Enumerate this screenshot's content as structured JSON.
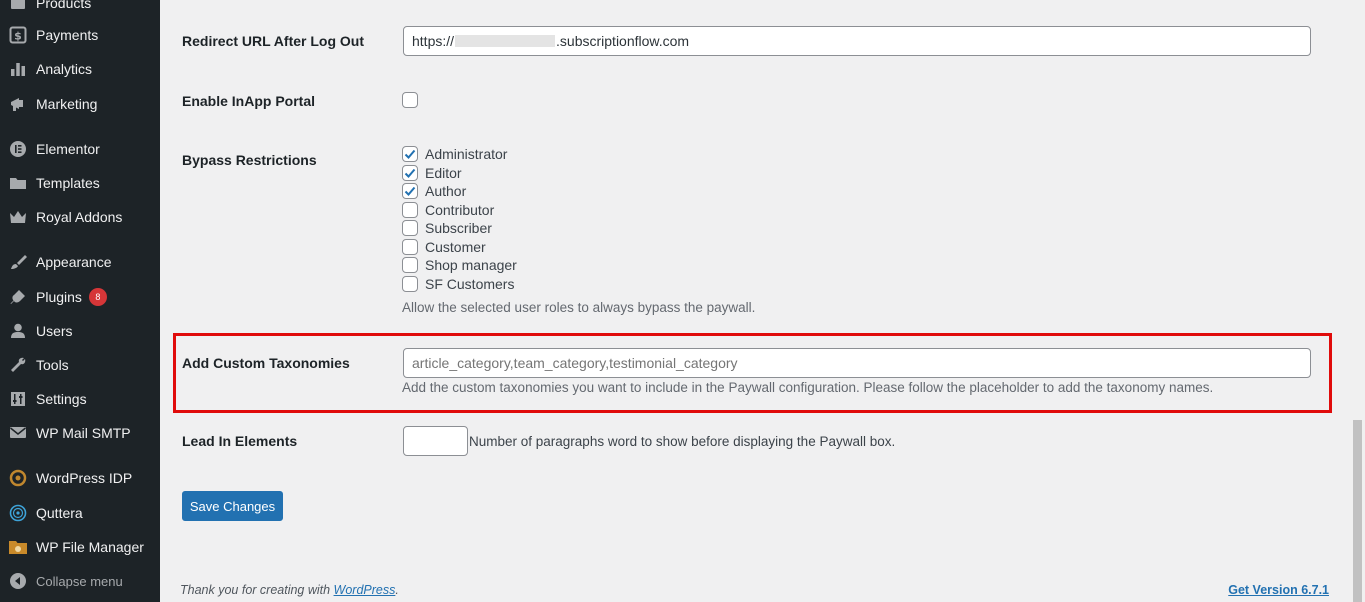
{
  "sidebar": {
    "items": [
      {
        "label": "Products",
        "icon": "archive-icon"
      },
      {
        "label": "Payments",
        "icon": "dollar-icon"
      },
      {
        "label": "Analytics",
        "icon": "bar-chart-icon"
      },
      {
        "label": "Marketing",
        "icon": "megaphone-icon"
      },
      {
        "label": "Elementor",
        "icon": "elementor-icon"
      },
      {
        "label": "Templates",
        "icon": "folder-icon"
      },
      {
        "label": "Royal Addons",
        "icon": "crown-icon"
      },
      {
        "label": "Appearance",
        "icon": "brush-icon"
      },
      {
        "label": "Plugins",
        "icon": "plugin-icon",
        "badge": "8"
      },
      {
        "label": "Users",
        "icon": "user-icon"
      },
      {
        "label": "Tools",
        "icon": "wrench-icon"
      },
      {
        "label": "Settings",
        "icon": "sliders-icon"
      },
      {
        "label": "WP Mail SMTP",
        "icon": "mail-icon"
      },
      {
        "label": "WordPress IDP",
        "icon": "idp-icon"
      },
      {
        "label": "Quttera",
        "icon": "quttera-icon"
      },
      {
        "label": "WP File Manager",
        "icon": "file-manager-icon"
      }
    ],
    "collapse_label": "Collapse menu"
  },
  "form": {
    "redirect": {
      "label": "Redirect URL After Log Out",
      "value_prefix": "https://",
      "value_suffix": ".subscriptionflow.com"
    },
    "inapp": {
      "label": "Enable InApp Portal"
    },
    "bypass": {
      "label": "Bypass Restrictions",
      "roles": [
        {
          "name": "Administrator",
          "checked": true
        },
        {
          "name": "Editor",
          "checked": true
        },
        {
          "name": "Author",
          "checked": true
        },
        {
          "name": "Contributor",
          "checked": false
        },
        {
          "name": "Subscriber",
          "checked": false
        },
        {
          "name": "Customer",
          "checked": false
        },
        {
          "name": "Shop manager",
          "checked": false
        },
        {
          "name": "SF Customers",
          "checked": false
        }
      ],
      "description": "Allow the selected user roles to always bypass the paywall."
    },
    "taxonomies": {
      "label": "Add Custom Taxonomies",
      "placeholder": "article_category,team_category,testimonial_category",
      "description": "Add the custom taxonomies you want to include in the Paywall configuration. Please follow the placeholder to add the taxonomy names."
    },
    "lead": {
      "label": "Lead In Elements",
      "description": "Number of paragraphs word to show before displaying the Paywall box."
    },
    "save_label": "Save Changes"
  },
  "footer": {
    "thanks_prefix": "Thank you for creating with ",
    "thanks_link": "WordPress",
    "thanks_suffix": ".",
    "version_link": "Get Version 6.7.1"
  },
  "colors": {
    "sidebar_bg": "#1d2327",
    "page_bg": "#f0f0f1",
    "accent": "#2271b1",
    "highlight": "#e00b0b",
    "badge": "#d63638"
  }
}
